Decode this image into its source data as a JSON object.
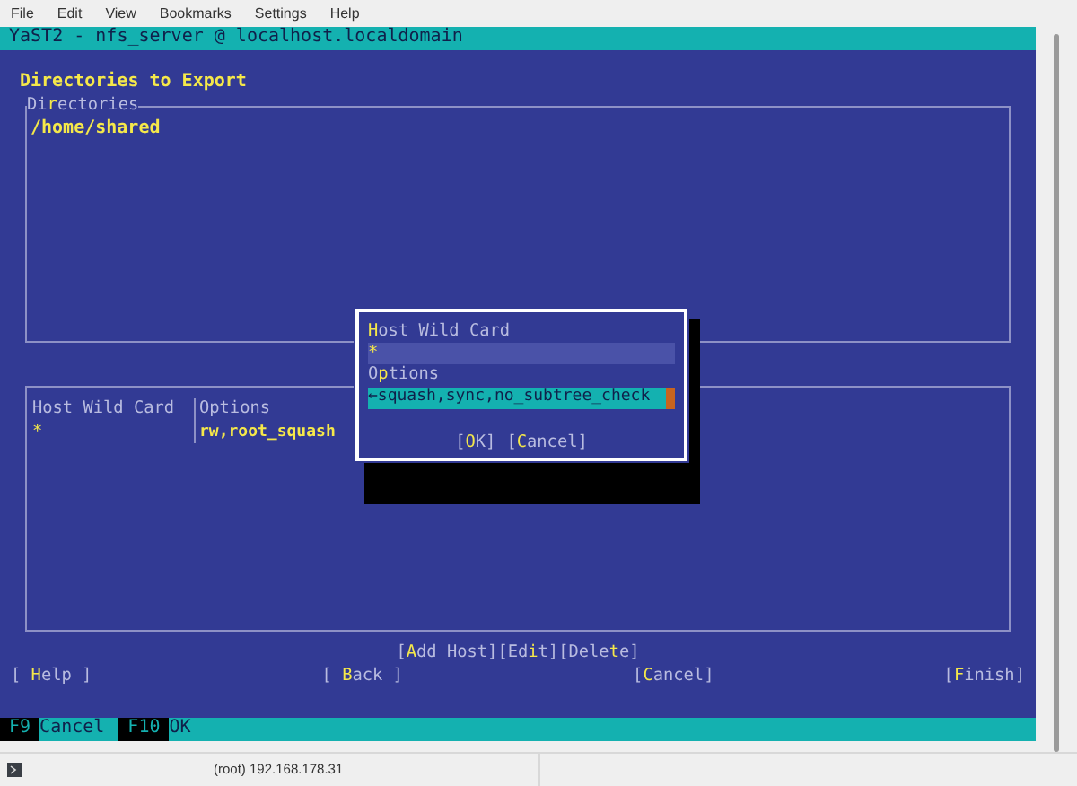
{
  "menu": [
    "File",
    "Edit",
    "View",
    "Bookmarks",
    "Settings",
    "Help"
  ],
  "terminal": {
    "title": "YaST2 - nfs_server @ localhost.localdomain",
    "heading": "Directories to Export",
    "directories": {
      "label": "Di**r**ectories",
      "items": [
        "/home/shared"
      ]
    },
    "hosts": {
      "columns": [
        "Host Wild Card",
        "Options"
      ],
      "rows": [
        [
          "*",
          "rw,root_squash"
        ]
      ]
    },
    "host_buttons": [
      "[**A**dd Host]",
      "[Ed**i**t]",
      "[Dele**t**e]"
    ],
    "nav_buttons": [
      "[ **H**elp ]",
      "[ **B**ack ]",
      "[**C**ancel]",
      "[**F**inish]"
    ],
    "fkeys": [
      {
        "key": "F9",
        "label": "Cancel"
      },
      {
        "key": "F10",
        "label": "OK"
      }
    ],
    "dialog": {
      "fields": [
        {
          "label": "**H**ost Wild Card",
          "value": "*",
          "focused": false
        },
        {
          "label": "O**p**tions",
          "value": "←squash,sync,no_subtree_check",
          "focused": true
        }
      ],
      "buttons": [
        "[**O**K]",
        "[**C**ancel]"
      ]
    }
  },
  "status_bar": {
    "text": "(root) 192.168.178.31"
  }
}
